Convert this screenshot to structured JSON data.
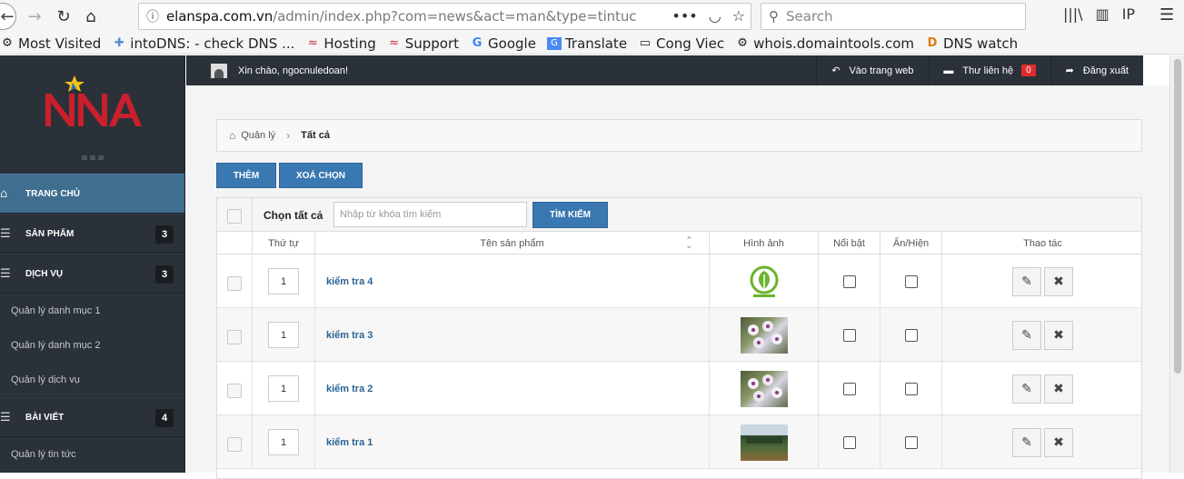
{
  "browser": {
    "url_host": "elanspa.com.vn",
    "url_path": "/admin/index.php?com=news&act=man&type=tintuc",
    "search_placeholder": "Search",
    "bookmarks": [
      {
        "label": "Most Visited",
        "icon": "gear-icon"
      },
      {
        "label": "intoDNS: - check DNS ...",
        "icon": "puzzle-icon"
      },
      {
        "label": "Hosting",
        "icon": "hosting-icon"
      },
      {
        "label": "Support",
        "icon": "support-icon"
      },
      {
        "label": "Google",
        "icon": "google-icon"
      },
      {
        "label": "Translate",
        "icon": "translate-icon"
      },
      {
        "label": "Cong Viec",
        "icon": "folder-icon"
      },
      {
        "label": "whois.domaintools.com",
        "icon": "gear-icon"
      },
      {
        "label": "DNS watch",
        "icon": "d-icon"
      }
    ]
  },
  "sidebar": {
    "items": [
      {
        "label": "TRANG CHỦ",
        "icon": "home-icon",
        "active": true
      },
      {
        "label": "SẢN PHẨM",
        "icon": "list-icon",
        "count": "3"
      },
      {
        "label": "DỊCH VỤ",
        "icon": "list-icon",
        "count": "3"
      }
    ],
    "dichvu_sub": [
      "Quản lý danh mục 1",
      "Quản lý danh mục 2",
      "Quản lý dịch vụ"
    ],
    "baiviet": {
      "label": "BÀI VIẾT",
      "icon": "list-icon",
      "count": "4"
    },
    "baiviet_sub": [
      "Quản lý tin tức"
    ]
  },
  "topbar": {
    "greeting": "Xin chào, ngocnuledoan!",
    "links": [
      {
        "label": "Vào trang web",
        "icon": "reply-icon"
      },
      {
        "label": "Thư liên hệ",
        "icon": "comment-icon",
        "badge": "0"
      },
      {
        "label": "Đăng xuất",
        "icon": "share-icon"
      }
    ]
  },
  "breadcrumb": {
    "parent": "Quản lý",
    "current": "Tất cả"
  },
  "toolbar": {
    "add_label": "THÊM",
    "delete_label": "XOÁ CHỌN"
  },
  "filter": {
    "select_all": "Chọn tất cả",
    "search_placeholder": "Nhập từ khóa tìm kiếm",
    "search_button": "TÌM KIẾM"
  },
  "table": {
    "headers": [
      "Thứ tự",
      "Tên sản phẩm",
      "Hình ảnh",
      "Nổi bật",
      "Ẩn/Hiện",
      "Thao tác"
    ],
    "rows": [
      {
        "order": "1",
        "name": "kiểm tra 4",
        "image": "leaf-logo"
      },
      {
        "order": "1",
        "name": "kiểm tra 3",
        "image": "orchid-photo"
      },
      {
        "order": "1",
        "name": "kiểm tra 2",
        "image": "orchid-photo"
      },
      {
        "order": "1",
        "name": "kiểm tra 1",
        "image": "landscape-photo"
      }
    ]
  },
  "colors": {
    "sidebar_bg": "#2b3138",
    "accent_blue": "#3a78b2",
    "active_nav": "#3f6e8f",
    "badge_red": "#e02e2e",
    "link_blue": "#2a6496"
  }
}
